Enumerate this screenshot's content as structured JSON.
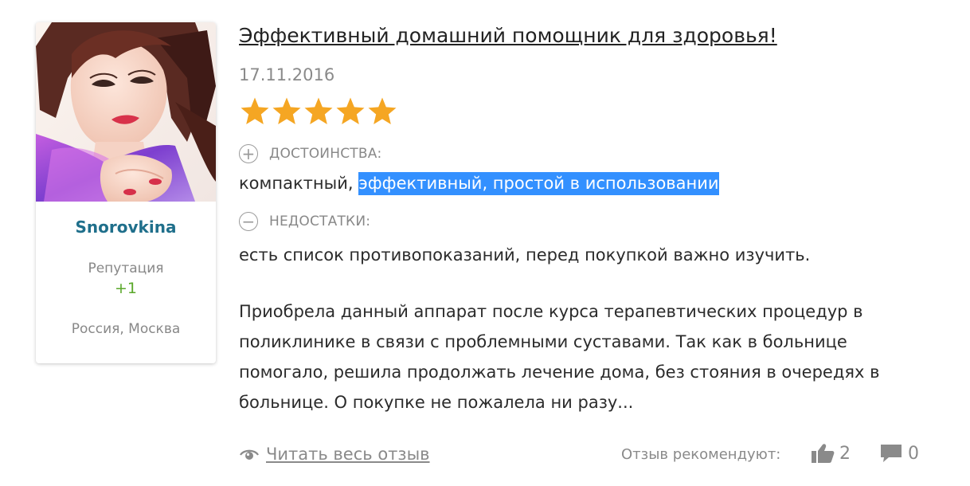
{
  "author": {
    "name": "Snorovkina",
    "reputation_label": "Репутация",
    "reputation_value": "+1",
    "location": "Россия, Москва"
  },
  "review": {
    "title": "Эффективный домашний помощник для здоровья!",
    "date": "17.11.2016",
    "rating": 5,
    "rating_max": 5,
    "pros_label": "ДОСТОИНСТВА:",
    "pros_plain": "компактный, ",
    "pros_selected": "эффективный, простой в использовании",
    "cons_label": "НЕДОСТАТКИ:",
    "cons_text": "есть список противопоказаний, перед покупкой важно изучить.",
    "body_lines": [
      "Приобрела данный аппарат после курса терапевтических процедур в",
      "поликлинике в связи с проблемными суставами. Так как в больнице",
      "помогало, решила продолжать лечение дома, без стояния в очередях в",
      "больнице. О покупке не пожалела ни разу..."
    ]
  },
  "footer": {
    "read_all_label": "Читать весь отзыв",
    "recommend_label": "Отзыв рекомендуют:",
    "likes_count": "2",
    "comments_count": "0"
  },
  "colors": {
    "star": "#f5a623",
    "username": "#1f6f8b",
    "reputation": "#5aa82a",
    "selection": "#3390ff"
  }
}
